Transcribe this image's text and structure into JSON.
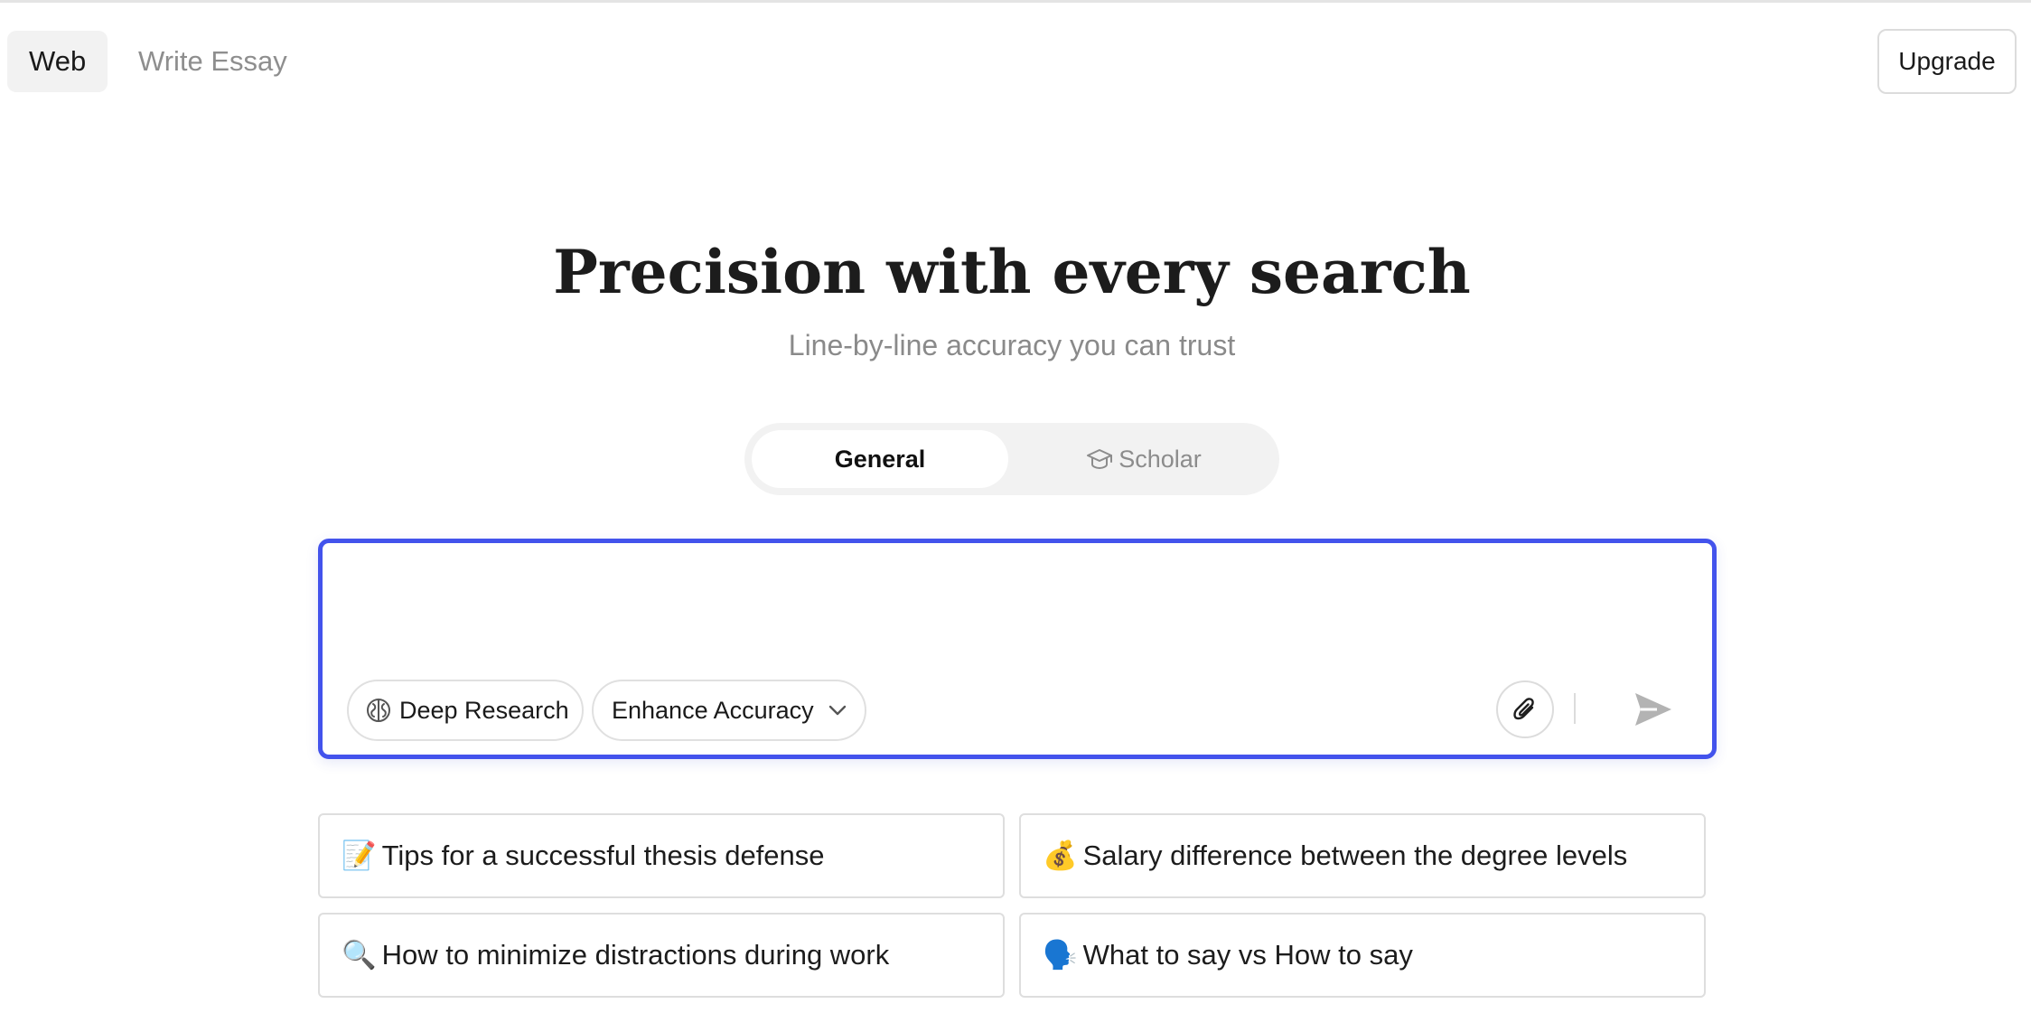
{
  "header": {
    "tabs": [
      {
        "label": "Web",
        "active": true
      },
      {
        "label": "Write Essay",
        "active": false
      }
    ],
    "upgrade_label": "Upgrade"
  },
  "hero": {
    "title": "Precision with every search",
    "subtitle": "Line-by-line accuracy you can trust"
  },
  "mode_toggle": {
    "options": [
      {
        "label": "General",
        "selected": true
      },
      {
        "label": "Scholar",
        "selected": false,
        "icon": "graduation-cap-icon"
      }
    ]
  },
  "search": {
    "value": "",
    "deep_research_label": "Deep Research",
    "enhance_label": "Enhance Accuracy",
    "accent_color": "#4353ec"
  },
  "suggestions": [
    {
      "emoji": "📝",
      "text": "Tips for a successful thesis defense"
    },
    {
      "emoji": "💰",
      "text": "Salary difference between the degree levels"
    },
    {
      "emoji": "🔍",
      "text": "How to minimize distractions during work"
    },
    {
      "emoji": "🗣️",
      "text": "What to say vs How to say"
    }
  ]
}
